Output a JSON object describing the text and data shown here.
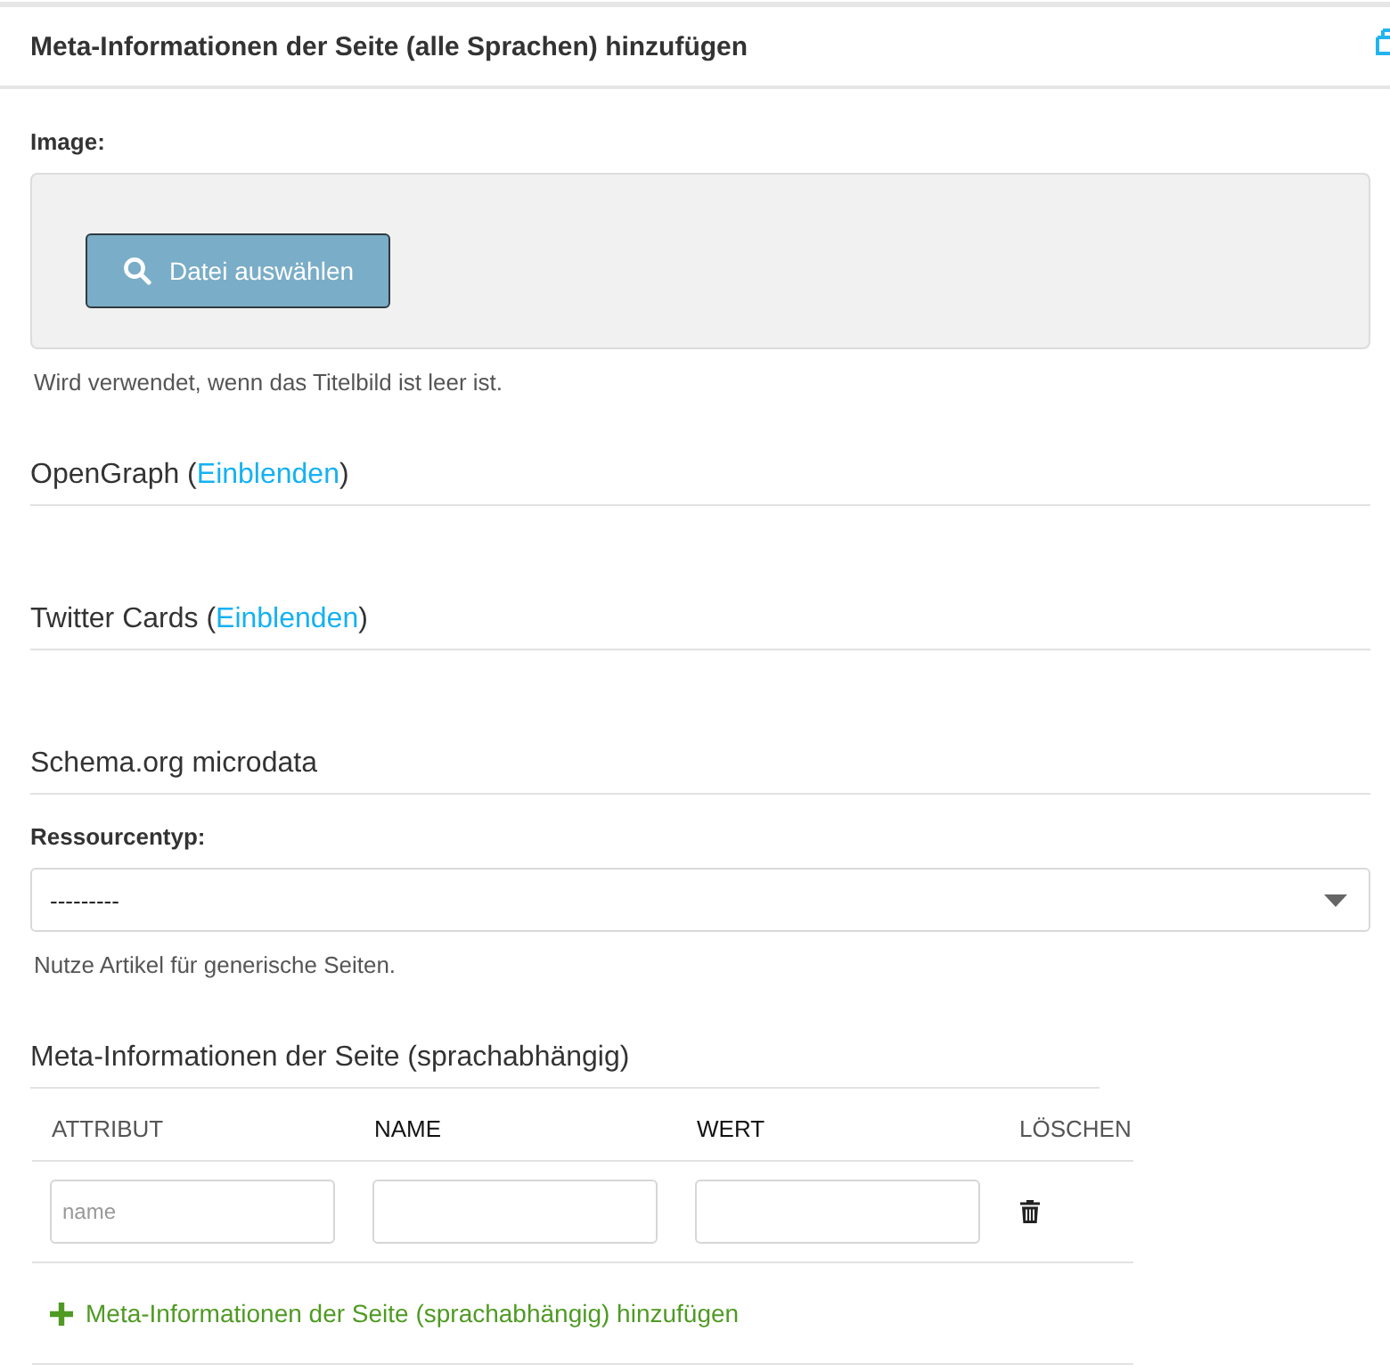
{
  "header": {
    "title": "Meta-Informationen der Seite (alle Sprachen) hinzufügen"
  },
  "image": {
    "label": "Image:",
    "button": "Datei auswählen",
    "help": "Wird verwendet, wenn das Titelbild ist leer ist."
  },
  "sections": [
    {
      "before": "OpenGraph (",
      "link": "Einblenden",
      "after": ")"
    },
    {
      "before": "Twitter Cards (",
      "link": "Einblenden",
      "after": ")"
    },
    {
      "before": "Schema.org microdata"
    }
  ],
  "resource_type": {
    "label": "Ressourcentyp:",
    "value": "---------",
    "help": "Nutze Artikel für generische Seiten."
  },
  "meta_table": {
    "title": "Meta-Informationen der Seite (sprachabhängig)",
    "columns": [
      {
        "label": "ATTRIBUT",
        "color": "#555555"
      },
      {
        "label": "NAME",
        "color": "#111111"
      },
      {
        "label": "WERT",
        "color": "#111111"
      },
      {
        "label": "LÖSCHEN",
        "color": "#555555"
      }
    ],
    "rows": [
      {
        "cells": [
          {
            "kind": "input",
            "placeholder": "name"
          },
          {
            "kind": "input"
          },
          {
            "kind": "input"
          },
          {
            "kind": "delete"
          }
        ]
      }
    ],
    "add_link": "Meta-Informationen der Seite (sprachabhängig) hinzufügen"
  }
}
